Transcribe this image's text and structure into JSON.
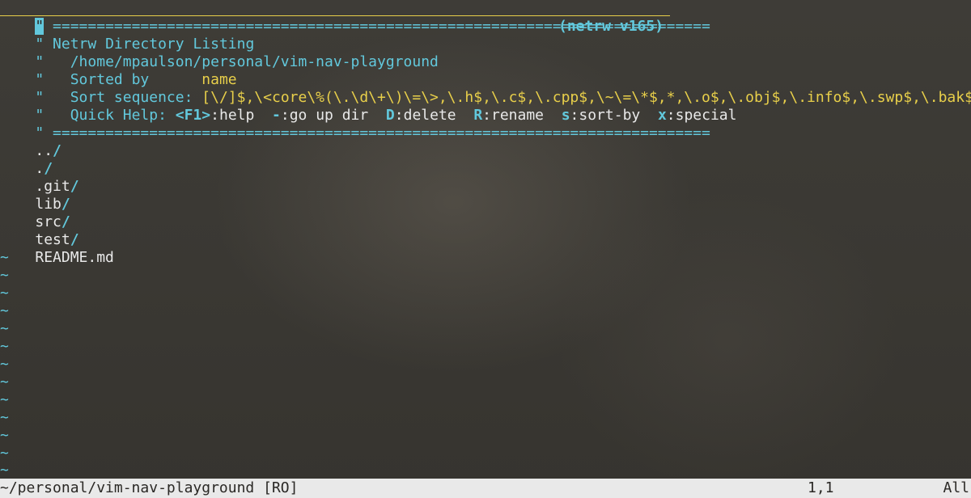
{
  "header": {
    "rule_top": "===========================================================================",
    "title_quote": "\"",
    "title": "Netrw Directory Listing",
    "version": "(netrw v165)",
    "path_quote": "\"",
    "path": "/home/mpaulson/personal/vim-nav-playground",
    "sorted_by_label": "Sorted by",
    "sorted_by_value": "name",
    "sort_sequence_label": "Sort sequence:",
    "sort_sequence_value": "[\\/]$,\\<core\\%(\\.\\d\\+\\)\\=\\>,\\.h$,\\.c$,\\.cpp$,\\~\\=\\*$,*,\\.o$,\\.obj$,\\.info$,\\.swp$,\\.bak$,\\~$",
    "quick_help_label": "Quick Help:",
    "quick_help": {
      "f1_key": "<F1>",
      "f1_desc": ":help",
      "up_key": "-",
      "up_desc": ":go up dir",
      "del_key": "D",
      "del_desc": ":delete",
      "ren_key": "R",
      "ren_desc": ":rename",
      "sort_key": "s",
      "sort_desc": ":sort-by",
      "special_key": "x",
      "special_desc": ":special"
    },
    "rule_bottom": "==========================================================================="
  },
  "entries": [
    {
      "name": "..",
      "slash": "/"
    },
    {
      "name": ".",
      "slash": "/"
    },
    {
      "name": ".git",
      "slash": "/"
    },
    {
      "name": "lib",
      "slash": "/"
    },
    {
      "name": "src",
      "slash": "/"
    },
    {
      "name": "test",
      "slash": "/"
    },
    {
      "name": "README.md",
      "slash": ""
    }
  ],
  "tilde": "~",
  "statusline": {
    "path": "~/personal/vim-nav-playground [RO]",
    "position": "1,1",
    "scroll": "All"
  },
  "colors": {
    "cyan": "#62c8dc",
    "yellow": "#e8cf4a",
    "text": "#e9e9e9",
    "statusbar_bg": "#e9e9e9"
  }
}
